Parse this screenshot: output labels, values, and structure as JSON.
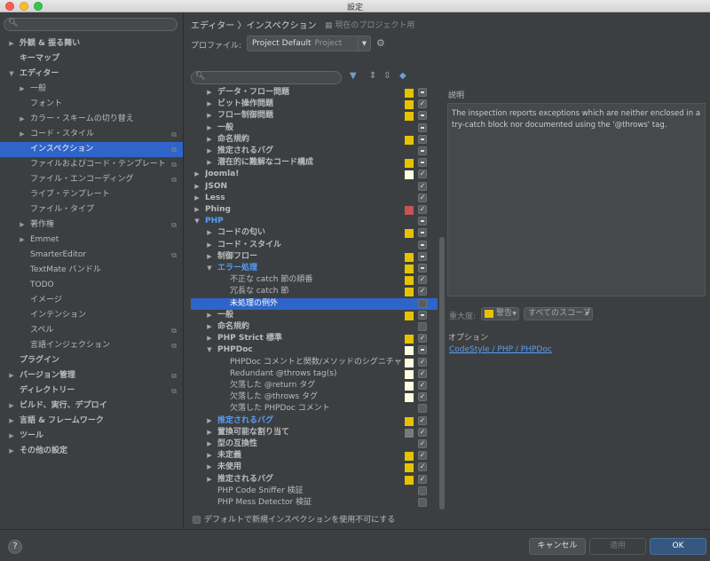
{
  "window": {
    "title": "設定"
  },
  "sidebar": {
    "search_placeholder": "",
    "items": [
      {
        "label": "外観 & 振る舞い",
        "level": 0,
        "arrow": "▶",
        "bold": true
      },
      {
        "label": "キーマップ",
        "level": 0,
        "arrow": "",
        "bold": true
      },
      {
        "label": "エディター",
        "level": 0,
        "arrow": "▼",
        "bold": true
      },
      {
        "label": "一般",
        "level": 1,
        "arrow": "▶"
      },
      {
        "label": "フォント",
        "level": 1,
        "arrow": ""
      },
      {
        "label": "カラー・スキームの切り替え",
        "level": 1,
        "arrow": "▶"
      },
      {
        "label": "コード・スタイル",
        "level": 1,
        "arrow": "▶",
        "copy": true
      },
      {
        "label": "インスペクション",
        "level": 1,
        "arrow": "",
        "copy": true,
        "selected": true
      },
      {
        "label": "ファイルおよびコード・テンプレート",
        "level": 1,
        "arrow": "",
        "copy": true
      },
      {
        "label": "ファイル・エンコーディング",
        "level": 1,
        "arrow": "",
        "copy": true
      },
      {
        "label": "ライブ・テンプレート",
        "level": 1,
        "arrow": ""
      },
      {
        "label": "ファイル・タイプ",
        "level": 1,
        "arrow": ""
      },
      {
        "label": "著作権",
        "level": 1,
        "arrow": "▶",
        "copy": true
      },
      {
        "label": "Emmet",
        "level": 1,
        "arrow": "▶"
      },
      {
        "label": "SmarterEditor",
        "level": 1,
        "arrow": "",
        "copy": true
      },
      {
        "label": "TextMate バンドル",
        "level": 1,
        "arrow": ""
      },
      {
        "label": "TODO",
        "level": 1,
        "arrow": ""
      },
      {
        "label": "イメージ",
        "level": 1,
        "arrow": ""
      },
      {
        "label": "インテンション",
        "level": 1,
        "arrow": ""
      },
      {
        "label": "スペル",
        "level": 1,
        "arrow": "",
        "copy": true
      },
      {
        "label": "言語インジェクション",
        "level": 1,
        "arrow": "",
        "copy": true
      },
      {
        "label": "プラグイン",
        "level": 0,
        "arrow": "",
        "bold": true
      },
      {
        "label": "バージョン管理",
        "level": 0,
        "arrow": "▶",
        "bold": true,
        "copy": true
      },
      {
        "label": "ディレクトリー",
        "level": 0,
        "arrow": "",
        "bold": true,
        "copy": true
      },
      {
        "label": "ビルド、実行、デプロイ",
        "level": 0,
        "arrow": "▶",
        "bold": true
      },
      {
        "label": "言語 & フレームワーク",
        "level": 0,
        "arrow": "▶",
        "bold": true
      },
      {
        "label": "ツール",
        "level": 0,
        "arrow": "▶",
        "bold": true
      },
      {
        "label": "その他の設定",
        "level": 0,
        "arrow": "▶",
        "bold": true
      }
    ]
  },
  "header": {
    "breadcrumb": "エディター 〉インスペクション",
    "project_hint": "現在のプロジェクト用",
    "profile_label": "プロファイル:",
    "profile_value": "Project Default",
    "profile_sub": "Project"
  },
  "inspections": [
    {
      "label": "データ・フロー問題",
      "level": 1,
      "arrow": "▶",
      "bold": true,
      "swatch": "#e5c300",
      "check": "partial"
    },
    {
      "label": "ビット操作問題",
      "level": 1,
      "arrow": "▶",
      "bold": true,
      "swatch": "#e5c300",
      "check": "checked"
    },
    {
      "label": "フロー制御問題",
      "level": 1,
      "arrow": "▶",
      "bold": true,
      "swatch": "#e5c300",
      "check": "partial"
    },
    {
      "label": "一般",
      "level": 1,
      "arrow": "▶",
      "bold": true,
      "swatch": "",
      "check": "partial"
    },
    {
      "label": "命名規約",
      "level": 1,
      "arrow": "▶",
      "bold": true,
      "swatch": "#e5c300",
      "check": "partial"
    },
    {
      "label": "推定されるバグ",
      "level": 1,
      "arrow": "▶",
      "bold": true,
      "swatch": "",
      "check": "partial"
    },
    {
      "label": "潜在的に難解なコード構成",
      "level": 1,
      "arrow": "▶",
      "bold": true,
      "swatch": "#e5c300",
      "check": "partial"
    },
    {
      "label": "Joomla!",
      "level": 0,
      "arrow": "▶",
      "bold": true,
      "swatch": "#fffde0",
      "check": "checked"
    },
    {
      "label": "JSON",
      "level": 0,
      "arrow": "▶",
      "bold": true,
      "swatch": "",
      "check": "checked"
    },
    {
      "label": "Less",
      "level": 0,
      "arrow": "▶",
      "bold": true,
      "swatch": "",
      "check": "checked"
    },
    {
      "label": "Phing",
      "level": 0,
      "arrow": "▶",
      "bold": true,
      "swatch": "#c75450",
      "check": "checked"
    },
    {
      "label": "PHP",
      "level": 0,
      "arrow": "▼",
      "bold": true,
      "blue": true,
      "swatch": "",
      "check": "partial"
    },
    {
      "label": "コードの匂い",
      "level": 1,
      "arrow": "▶",
      "bold": true,
      "swatch": "#e5c300",
      "check": "partial"
    },
    {
      "label": "コード・スタイル",
      "level": 1,
      "arrow": "▶",
      "bold": true,
      "swatch": "",
      "check": "partial"
    },
    {
      "label": "制御フロー",
      "level": 1,
      "arrow": "▶",
      "bold": true,
      "swatch": "#e5c300",
      "check": "partial"
    },
    {
      "label": "エラー処理",
      "level": 1,
      "arrow": "▼",
      "bold": true,
      "blue": true,
      "swatch": "#e5c300",
      "check": "partial"
    },
    {
      "label": "不正な catch 節の順番",
      "level": 2,
      "arrow": "",
      "swatch": "#e5c300",
      "check": "checked"
    },
    {
      "label": "冗長な catch 節",
      "level": 2,
      "arrow": "",
      "swatch": "#e5c300",
      "check": "checked"
    },
    {
      "label": "未処理の例外",
      "level": 2,
      "arrow": "",
      "swatch": "",
      "check": "empty",
      "selected": true
    },
    {
      "label": "一般",
      "level": 1,
      "arrow": "▶",
      "bold": true,
      "swatch": "#e5c300",
      "check": "partial"
    },
    {
      "label": "命名規約",
      "level": 1,
      "arrow": "▶",
      "bold": true,
      "swatch": "",
      "check": "empty"
    },
    {
      "label": "PHP Strict 標準",
      "level": 1,
      "arrow": "▶",
      "bold": true,
      "swatch": "#e5c300",
      "check": "checked"
    },
    {
      "label": "PHPDoc",
      "level": 1,
      "arrow": "▼",
      "bold": true,
      "swatch": "#fffde0",
      "check": "partial"
    },
    {
      "label": "PHPDoc コメントと関数/メソッドのシグニチャ",
      "level": 2,
      "arrow": "",
      "swatch": "#fffde0",
      "check": "checked"
    },
    {
      "label": "Redundant @throws tag(s)",
      "level": 2,
      "arrow": "",
      "swatch": "#fffde0",
      "check": "checked"
    },
    {
      "label": "欠落した @return タグ",
      "level": 2,
      "arrow": "",
      "swatch": "#fffde0",
      "check": "checked"
    },
    {
      "label": "欠落した @throws タグ",
      "level": 2,
      "arrow": "",
      "swatch": "#fffde0",
      "check": "checked"
    },
    {
      "label": "欠落した PHPDoc コメント",
      "level": 2,
      "arrow": "",
      "swatch": "",
      "check": "empty"
    },
    {
      "label": "推定されるバグ",
      "level": 1,
      "arrow": "▶",
      "bold": true,
      "blue": true,
      "swatch": "#e5c300",
      "check": "checked"
    },
    {
      "label": "置換可能な割り当て",
      "level": 1,
      "arrow": "▶",
      "bold": true,
      "swatch": "#7a7a7a",
      "check": "checked"
    },
    {
      "label": "型の互換性",
      "level": 1,
      "arrow": "▶",
      "bold": true,
      "swatch": "",
      "check": "checked"
    },
    {
      "label": "未定義",
      "level": 1,
      "arrow": "▶",
      "bold": true,
      "swatch": "#e5c300",
      "check": "checked"
    },
    {
      "label": "未使用",
      "level": 1,
      "arrow": "▶",
      "bold": true,
      "swatch": "#e5c300",
      "check": "checked"
    },
    {
      "label": "推定されるバグ",
      "level": 1,
      "arrow": "▶",
      "bold": true,
      "swatch": "#e5c300",
      "check": "checked"
    },
    {
      "label": "PHP Code Sniffer 検証",
      "level": 1,
      "arrow": "",
      "swatch": "",
      "check": "empty"
    },
    {
      "label": "PHP Mess Detector 検証",
      "level": 1,
      "arrow": "",
      "swatch": "",
      "check": "empty"
    }
  ],
  "bottom_check_label": "デフォルトで新規インスペクションを使用不可にする",
  "description": {
    "title": "説明",
    "text": "The inspection reports exceptions which are neither enclosed in a try-catch block nor documented using the '@throws' tag."
  },
  "severity": {
    "label": "重大度:",
    "value": "警告",
    "scope": "すべてのスコープ",
    "color": "#e5c300"
  },
  "options": {
    "title": "オプション",
    "link": "CodeStyle / PHP / PHPDoc"
  },
  "buttons": {
    "cancel": "キャンセル",
    "apply": "適用",
    "ok": "OK",
    "help": "?"
  }
}
